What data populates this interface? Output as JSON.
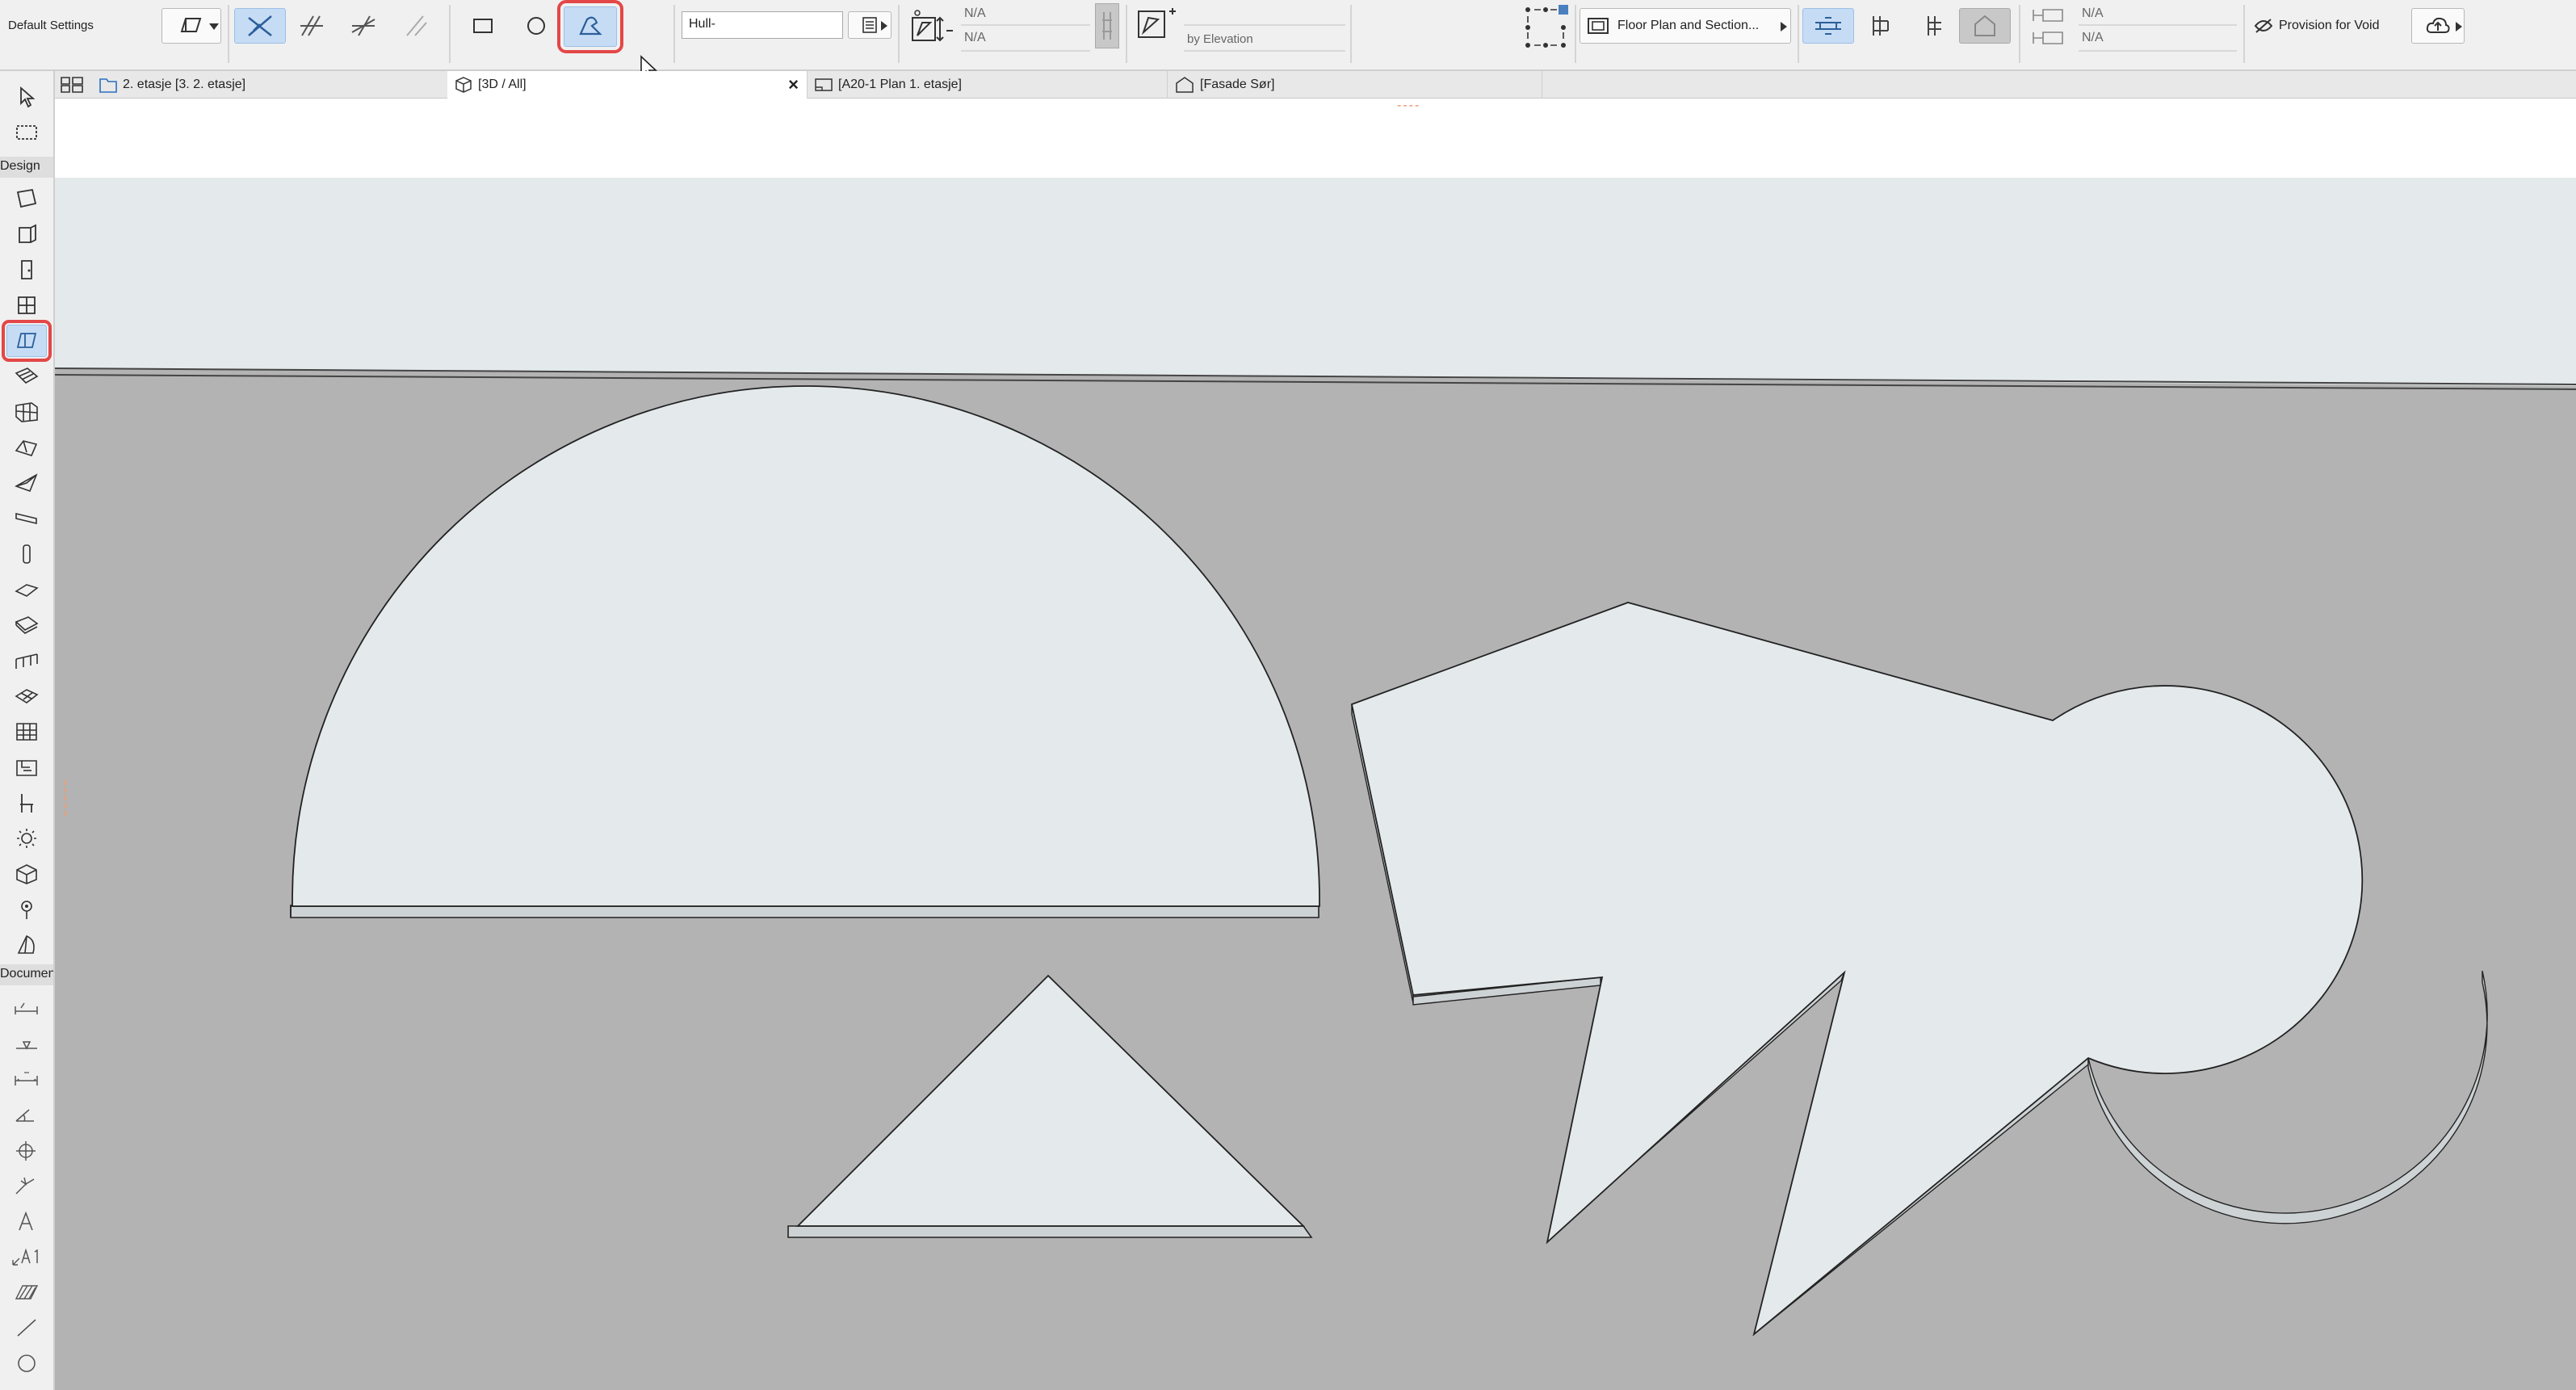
{
  "infobox": {
    "default_settings": "Default Settings",
    "layer_value": "Hull-",
    "na_top_1": "N/A",
    "na_bottom_1": "N/A",
    "elevation_label": "by Elevation",
    "floor_plan_label": "Floor Plan and Section...",
    "na_top_2": "N/A",
    "na_bottom_2": "N/A",
    "provision_label": "Provision for Void"
  },
  "toolbox": {
    "design_header": "Design",
    "document_header": "Documen"
  },
  "tabs": [
    {
      "label": "2. etasje [3. 2. etasje]"
    },
    {
      "label": "[3D / All]",
      "close": "×"
    },
    {
      "label": "[A20-1 Plan 1. etasje]"
    },
    {
      "label": "[Fasade Sør]"
    }
  ],
  "view": {
    "orange_marker": "----"
  },
  "colors": {
    "toolbar_bg": "#f0f0f0",
    "active_blue": "#c6dcf5",
    "highlight_red": "#e34747",
    "ground_gray": "#b3b3b3",
    "sky_gray": "#e4e9eb",
    "slab_fill": "#e4e9eb",
    "slab_side": "#cdd2d4"
  }
}
